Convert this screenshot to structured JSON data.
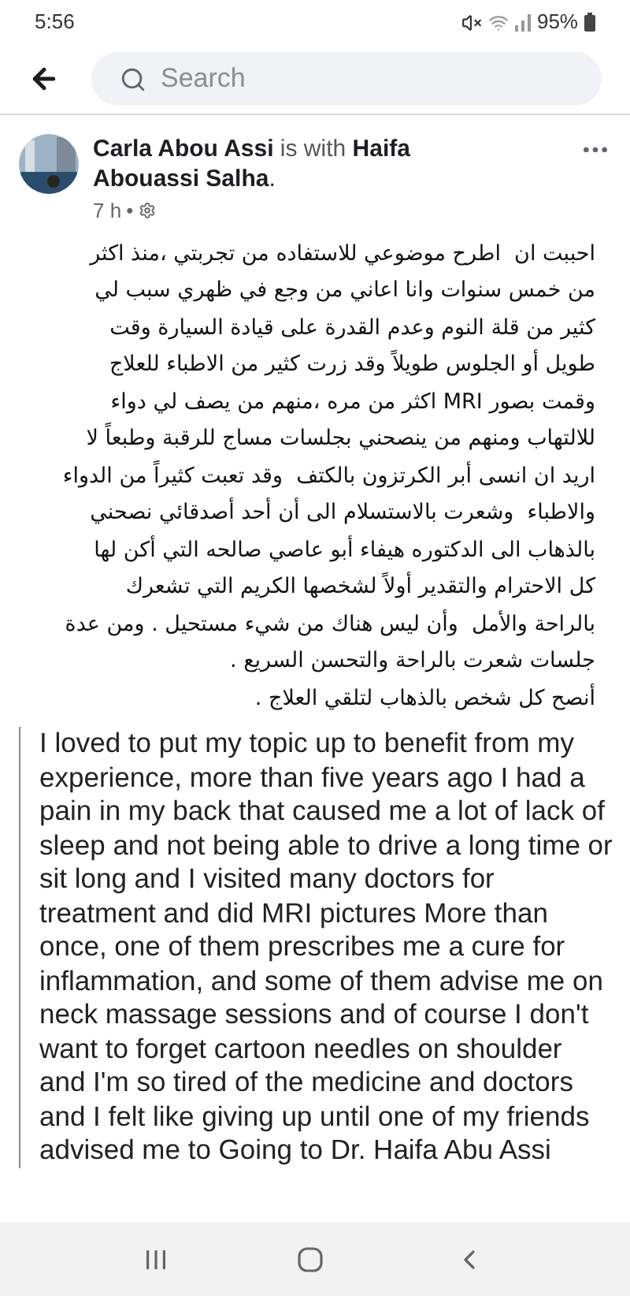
{
  "status_bar": {
    "time": "5:56",
    "battery": "95%"
  },
  "search": {
    "placeholder": "Search"
  },
  "post": {
    "author": "Carla Abou Assi",
    "connector": "is with",
    "tagged": "Haifa Abouassi Salha",
    "end_mark": ".",
    "time": "7 h",
    "separator": "•",
    "arabic_lines": [
      "احببت ان  اطرح موضوعي للاستفاده من تجربتي ،منذ اكثر",
      "من خمس سنوات وانا اعاني من وجع في ظهري سبب لي",
      "كثير من قلة النوم وعدم القدرة على قيادة السيارة وقت",
      "طويل أو الجلوس طويلاً وقد زرت كثير من الاطباء للعلاج",
      "وقمت بصور MRI اكثر من مره ،منهم من يصف لي دواء",
      "للالتهاب ومنهم من ينصحني بجلسات مساج للرقبة وطبعاً لا",
      "اريد ان انسى أبر الكرتزون بالكتف  وقد تعبت كثيراً من الدواء",
      "والاطباء  وشعرت بالاستسلام الى أن أحد أصدقائي نصحني",
      "بالذهاب الى الدكتوره هيفاء أبو عاصي صالحه التي أكن لها",
      "كل الاحترام والتقدير أولاً لشخصها الكريم التي تشعرك",
      "بالراحة والأمل  وأن ليس هناك من شيء مستحيل . ومن عدة",
      "جلسات شعرت بالراحة والتحسن السريع .",
      "أنصح كل شخص بالذهاب لتلقي العلاج ."
    ],
    "english_lines": [
      "I loved to put my topic up to benefit from my",
      "experience, more than five years ago I had a",
      "pain in my back that caused me a lot of lack of",
      "sleep and not being able to drive a long time or",
      "sit long and I visited many doctors for",
      "treatment and did MRI pictures More than",
      "once, one of them prescribes me a cure for",
      "inflammation, and some of them advise me on",
      "neck massage sessions and of course I don't",
      "want to forget cartoon needles on shoulder",
      "and I'm so tired of the medicine and doctors",
      "and I felt like giving up until one of my friends",
      "advised me to Going to Dr. Haifa Abu Assi"
    ]
  }
}
